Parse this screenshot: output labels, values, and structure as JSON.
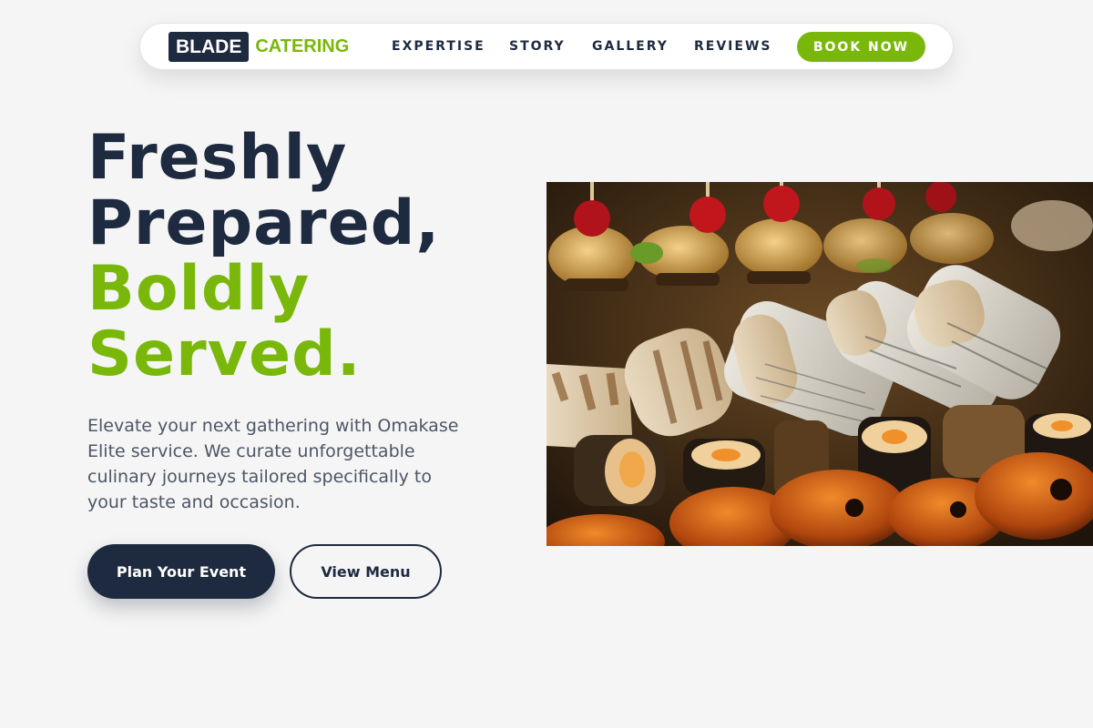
{
  "nav": {
    "logo_box": "BLADE",
    "logo_text": "CATERING",
    "links": [
      "EXPERTISE",
      "STORY",
      "GALLERY",
      "REVIEWS"
    ],
    "cta": "BOOK NOW"
  },
  "hero": {
    "headline_line1": "Freshly",
    "headline_line2": "Prepared,",
    "headline_line3": "Boldly",
    "headline_line4": "Served.",
    "description": "Elevate your next gathering with Omakase Elite service. We curate unforgettable culinary journeys tailored specifically to your taste and occasion.",
    "primary_button": "Plan Your Event",
    "secondary_button": "View Menu"
  },
  "colors": {
    "navy": "#1e2a3f",
    "accent_green": "#79b80a",
    "background": "#f5f5f5",
    "body_text": "#4d5566"
  }
}
